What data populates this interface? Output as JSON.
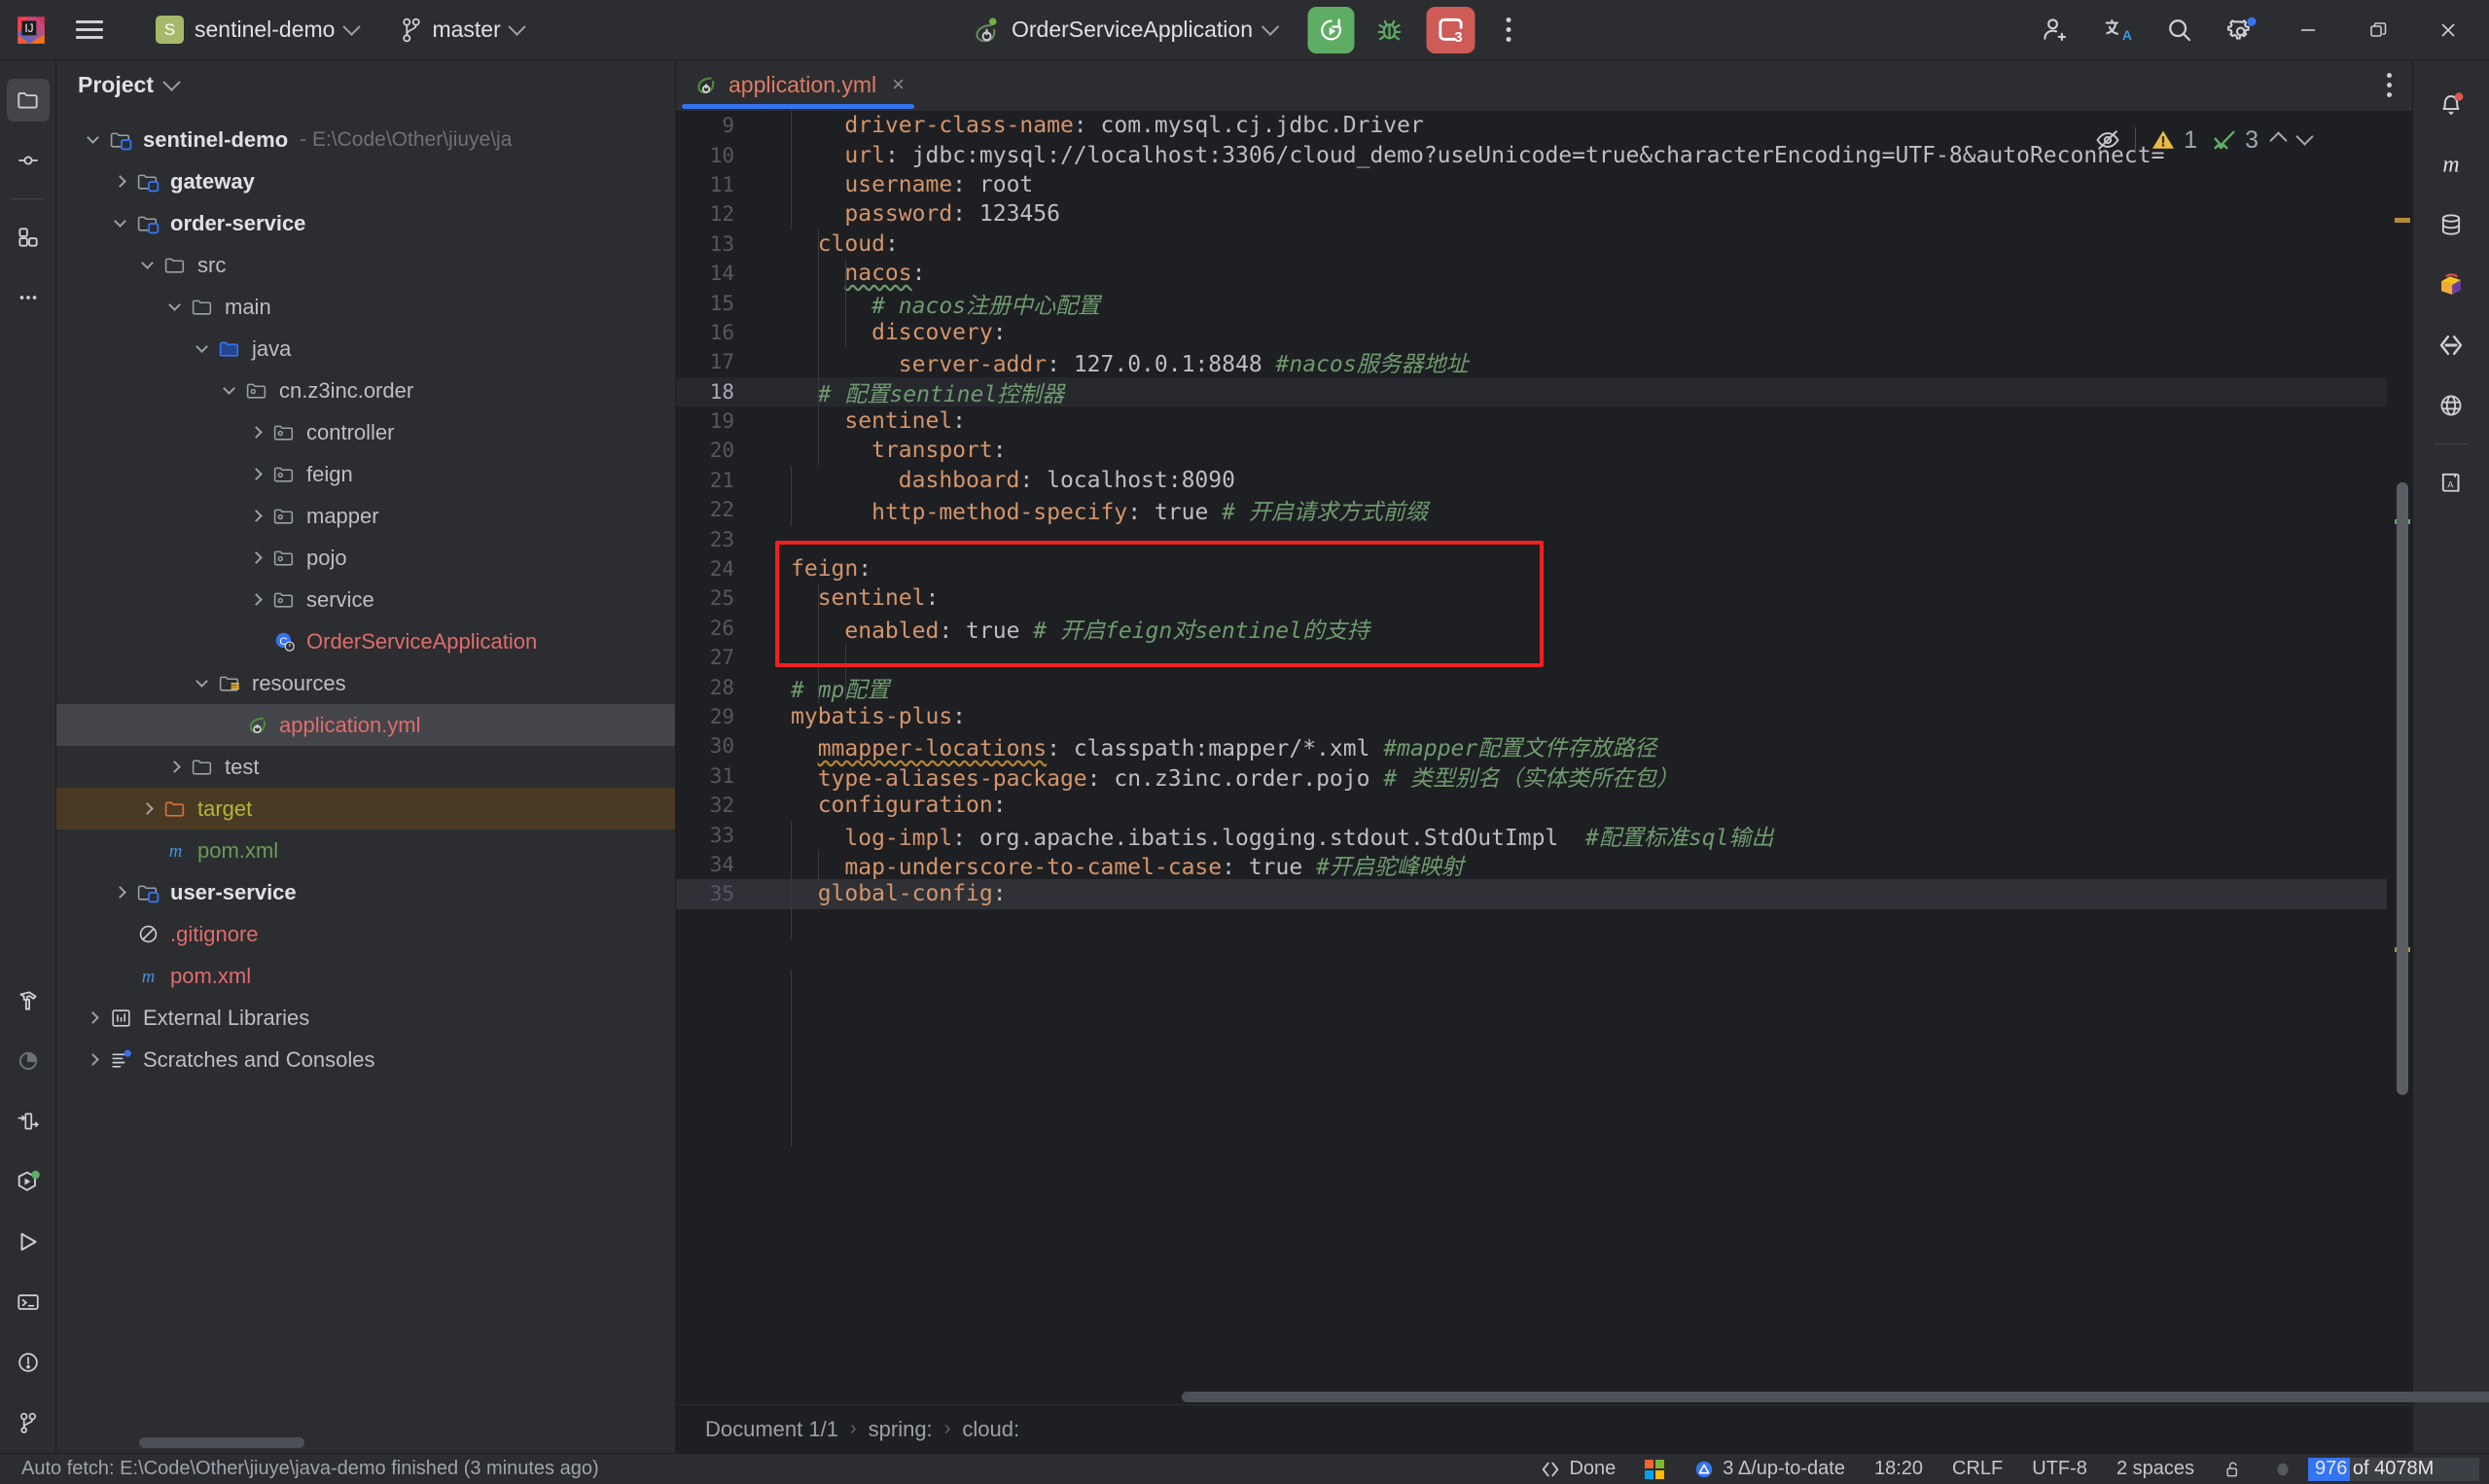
{
  "titlebar": {
    "menu_icon": "hamburger-icon",
    "project_badge": "S",
    "project_name": "sentinel-demo",
    "branch_name": "master",
    "run_config": "OrderServiceApplication",
    "run_button": "run-icon",
    "debug_button": "debug-icon",
    "services_button": "services-icon",
    "services_count": "3",
    "more_button": "more-vertical-icon",
    "right_icons": [
      "add-user-icon",
      "translate-icon",
      "search-icon",
      "settings-icon"
    ],
    "window_controls": [
      "minimize",
      "restore",
      "close"
    ]
  },
  "left_rail": {
    "icons": [
      {
        "name": "project-tool-window",
        "glyph": "folder-icon",
        "active": true
      },
      {
        "name": "commit-tool-window",
        "glyph": "commit-icon",
        "active": false
      },
      {
        "name": "structure-tool-window",
        "glyph": "structure-icon",
        "active": false
      },
      {
        "name": "more-tool-windows",
        "glyph": "more-horizontal-icon",
        "active": false
      },
      {
        "name": "build-tool-window",
        "glyph": "hammer-icon",
        "active": false
      },
      {
        "name": "profiler-tool-window",
        "glyph": "pie-icon",
        "active": false
      },
      {
        "name": "endpoints-tool-window",
        "glyph": "endpoints-icon",
        "active": false
      },
      {
        "name": "services-tool-window",
        "glyph": "services-play-icon",
        "active": false
      },
      {
        "name": "run-tool-window",
        "glyph": "play-icon",
        "active": false
      },
      {
        "name": "terminal-tool-window",
        "glyph": "terminal-icon",
        "active": false
      },
      {
        "name": "problems-tool-window",
        "glyph": "warning-circle-icon",
        "active": false
      },
      {
        "name": "git-tool-window",
        "glyph": "git-branch-icon",
        "active": false
      }
    ]
  },
  "right_rail": {
    "icons": [
      {
        "name": "notifications",
        "glyph": "bell-icon",
        "badge": true
      },
      {
        "name": "maven",
        "glyph": "maven-m-icon"
      },
      {
        "name": "database",
        "glyph": "database-icon"
      },
      {
        "name": "mybatisx",
        "glyph": "mybatisx-icon"
      },
      {
        "name": "codewith-me",
        "glyph": "code-with-me-icon"
      },
      {
        "name": "web-browser",
        "glyph": "globe-icon"
      },
      {
        "name": "translation",
        "glyph": "dictionary-icon"
      }
    ]
  },
  "project_panel": {
    "title": "Project",
    "tree": [
      {
        "depth": 0,
        "arrow": "down",
        "icon": "module-icon",
        "label": "sentinel-demo",
        "bold": true,
        "path": "- E:\\Code\\Other\\jiuye\\ja"
      },
      {
        "depth": 1,
        "arrow": "right",
        "icon": "module-icon",
        "label": "gateway",
        "bold": true
      },
      {
        "depth": 1,
        "arrow": "down",
        "icon": "module-icon",
        "label": "order-service",
        "bold": true
      },
      {
        "depth": 2,
        "arrow": "down",
        "icon": "folder-icon",
        "label": "src"
      },
      {
        "depth": 3,
        "arrow": "down",
        "icon": "folder-icon",
        "label": "main"
      },
      {
        "depth": 4,
        "arrow": "down",
        "icon": "source-root-icon",
        "label": "java"
      },
      {
        "depth": 5,
        "arrow": "down",
        "icon": "package-icon",
        "label": "cn.z3inc.order"
      },
      {
        "depth": 6,
        "arrow": "right",
        "icon": "package-icon",
        "label": "controller"
      },
      {
        "depth": 6,
        "arrow": "right",
        "icon": "package-icon",
        "label": "feign"
      },
      {
        "depth": 6,
        "arrow": "right",
        "icon": "package-icon",
        "label": "mapper"
      },
      {
        "depth": 6,
        "arrow": "right",
        "icon": "package-icon",
        "label": "pojo"
      },
      {
        "depth": 6,
        "arrow": "right",
        "icon": "package-icon",
        "label": "service"
      },
      {
        "depth": 6,
        "arrow": "none",
        "icon": "spring-class-icon",
        "label": "OrderServiceApplication",
        "color": "red"
      },
      {
        "depth": 4,
        "arrow": "down",
        "icon": "resource-root-icon",
        "label": "resources"
      },
      {
        "depth": 5,
        "arrow": "none",
        "icon": "spring-yml-icon",
        "label": "application.yml",
        "color": "red",
        "selected": true
      },
      {
        "depth": 3,
        "arrow": "right",
        "icon": "folder-icon",
        "label": "test"
      },
      {
        "depth": 2,
        "arrow": "right",
        "icon": "excluded-folder-icon",
        "label": "target",
        "color": "olive",
        "highlight": "target"
      },
      {
        "depth": 2,
        "arrow": "none",
        "icon": "maven-m-icon",
        "label": "pom.xml",
        "color": "green"
      },
      {
        "depth": 1,
        "arrow": "right",
        "icon": "module-icon",
        "label": "user-service",
        "bold": true
      },
      {
        "depth": 1,
        "arrow": "none",
        "icon": "gitignore-icon",
        "label": ".gitignore",
        "color": "red"
      },
      {
        "depth": 1,
        "arrow": "none",
        "icon": "maven-m-icon",
        "label": "pom.xml",
        "color": "red"
      },
      {
        "depth": 0,
        "arrow": "right",
        "icon": "libraries-icon",
        "label": "External Libraries"
      },
      {
        "depth": 0,
        "arrow": "right",
        "icon": "scratches-icon",
        "label": "Scratches and Consoles"
      }
    ]
  },
  "editor": {
    "tab": {
      "label": "application.yml",
      "icon": "spring-yml-icon",
      "close": "×"
    },
    "tabbar_more": "more-vertical-icon",
    "inspection_widget": {
      "hide_icon": "eye-crossed-icon",
      "warning_icon": "warning-triangle-icon",
      "warning_count": "1",
      "ok_icon": "check-squiggle-icon",
      "ok_count": "3",
      "prev_icon": "chevron-up-icon",
      "next_icon": "chevron-down-icon"
    },
    "lines": [
      {
        "n": "9",
        "indent": 2,
        "tokens": [
          {
            "t": "driver-class-name",
            "c": "k"
          },
          {
            "t": ": ",
            "c": "p"
          },
          {
            "t": "com.mysql.cj.jdbc.Driver",
            "c": "v"
          }
        ]
      },
      {
        "n": "10",
        "indent": 2,
        "tokens": [
          {
            "t": "url",
            "c": "k"
          },
          {
            "t": ": ",
            "c": "p"
          },
          {
            "t": "jdbc:mysql://localhost:3306/cloud_demo?useUnicode=true&characterEncoding=UTF-8&autoReconnect=",
            "c": "v"
          }
        ]
      },
      {
        "n": "11",
        "indent": 2,
        "tokens": [
          {
            "t": "username",
            "c": "k"
          },
          {
            "t": ": ",
            "c": "p"
          },
          {
            "t": "root",
            "c": "v"
          }
        ]
      },
      {
        "n": "12",
        "indent": 2,
        "tokens": [
          {
            "t": "password",
            "c": "k"
          },
          {
            "t": ": ",
            "c": "p"
          },
          {
            "t": "123456",
            "c": "v"
          }
        ]
      },
      {
        "n": "13",
        "indent": 1,
        "tokens": [
          {
            "t": "cloud",
            "c": "k"
          },
          {
            "t": ":",
            "c": "p"
          }
        ]
      },
      {
        "n": "14",
        "indent": 2,
        "tokens": [
          {
            "t": "nacos",
            "c": "k squig"
          },
          {
            "t": ":",
            "c": "p"
          }
        ]
      },
      {
        "n": "15",
        "indent": 3,
        "tokens": [
          {
            "t": "# nacos注册中心配置",
            "c": "cm"
          }
        ]
      },
      {
        "n": "16",
        "indent": 3,
        "tokens": [
          {
            "t": "discovery",
            "c": "k"
          },
          {
            "t": ":",
            "c": "p"
          }
        ]
      },
      {
        "n": "17",
        "indent": 4,
        "tokens": [
          {
            "t": "server-addr",
            "c": "k"
          },
          {
            "t": ": ",
            "c": "p"
          },
          {
            "t": "127.0.0.1:8848 ",
            "c": "v"
          },
          {
            "t": "#nacos服务器地址",
            "c": "cm"
          }
        ]
      },
      {
        "n": "18",
        "indent": 1,
        "hl": true,
        "tokens": [
          {
            "t": "# 配置sentinel控制器",
            "c": "cm"
          }
        ]
      },
      {
        "n": "19",
        "indent": 2,
        "tokens": [
          {
            "t": "sentinel",
            "c": "k"
          },
          {
            "t": ":",
            "c": "p"
          }
        ]
      },
      {
        "n": "20",
        "indent": 3,
        "tokens": [
          {
            "t": "transport",
            "c": "k"
          },
          {
            "t": ":",
            "c": "p"
          }
        ]
      },
      {
        "n": "21",
        "indent": 4,
        "tokens": [
          {
            "t": "dashboard",
            "c": "k"
          },
          {
            "t": ": ",
            "c": "p"
          },
          {
            "t": "localhost:8090",
            "c": "v"
          }
        ]
      },
      {
        "n": "22",
        "indent": 3,
        "tokens": [
          {
            "t": "http-method-specify",
            "c": "k"
          },
          {
            "t": ": ",
            "c": "p"
          },
          {
            "t": "true ",
            "c": "v"
          },
          {
            "t": "# 开启请求方式前缀",
            "c": "cm"
          }
        ]
      },
      {
        "n": "23",
        "indent": 0,
        "tokens": []
      },
      {
        "n": "24",
        "indent": 0,
        "tokens": [
          {
            "t": "feign",
            "c": "k"
          },
          {
            "t": ":",
            "c": "p"
          }
        ]
      },
      {
        "n": "25",
        "indent": 1,
        "tokens": [
          {
            "t": "sentinel",
            "c": "k"
          },
          {
            "t": ":",
            "c": "p"
          }
        ]
      },
      {
        "n": "26",
        "indent": 2,
        "tokens": [
          {
            "t": "enabled",
            "c": "k"
          },
          {
            "t": ": ",
            "c": "p"
          },
          {
            "t": "true ",
            "c": "v"
          },
          {
            "t": "# 开启feign对sentinel的支持",
            "c": "cm"
          }
        ]
      },
      {
        "n": "27",
        "indent": 0,
        "tokens": []
      },
      {
        "n": "28",
        "indent": 0,
        "tokens": [
          {
            "t": "# mp配置",
            "c": "cm"
          }
        ]
      },
      {
        "n": "29",
        "indent": 0,
        "tokens": [
          {
            "t": "mybatis-plus",
            "c": "k"
          },
          {
            "t": ":",
            "c": "p"
          }
        ]
      },
      {
        "n": "30",
        "indent": 1,
        "tokens": [
          {
            "t": "mmapper-locations",
            "c": "k squig-y"
          },
          {
            "t": ": ",
            "c": "p"
          },
          {
            "t": "classpath:mapper/*.xml ",
            "c": "v"
          },
          {
            "t": "#mapper配置文件存放路径",
            "c": "cm"
          }
        ]
      },
      {
        "n": "31",
        "indent": 1,
        "tokens": [
          {
            "t": "type-aliases-package",
            "c": "k"
          },
          {
            "t": ": ",
            "c": "p"
          },
          {
            "t": "cn.z3inc.order.pojo ",
            "c": "v"
          },
          {
            "t": "# 类型别名（实体类所在包）",
            "c": "cm"
          }
        ]
      },
      {
        "n": "32",
        "indent": 1,
        "tokens": [
          {
            "t": "configuration",
            "c": "k"
          },
          {
            "t": ":",
            "c": "p"
          }
        ]
      },
      {
        "n": "33",
        "indent": 2,
        "tokens": [
          {
            "t": "log-impl",
            "c": "k"
          },
          {
            "t": ": ",
            "c": "p"
          },
          {
            "t": "org.apache.ibatis.logging.stdout.StdOutImpl  ",
            "c": "v"
          },
          {
            "t": "#配置标准sql输出",
            "c": "cm"
          }
        ]
      },
      {
        "n": "34",
        "indent": 2,
        "tokens": [
          {
            "t": "map-underscore-to-camel-case",
            "c": "k"
          },
          {
            "t": ": ",
            "c": "p"
          },
          {
            "t": "true ",
            "c": "v"
          },
          {
            "t": "#开启驼峰映射",
            "c": "cm"
          }
        ]
      },
      {
        "n": "35",
        "indent": 1,
        "hl2": true,
        "tokens": [
          {
            "t": "global-config",
            "c": "k"
          },
          {
            "t": ":",
            "c": "p"
          }
        ]
      }
    ],
    "highlight_box": {
      "color": "#f02020",
      "from_line": "24",
      "to_line": "27"
    },
    "breadcrumbs": [
      {
        "label": "Document 1/1"
      },
      {
        "label": "spring:"
      },
      {
        "label": "cloud:"
      }
    ],
    "breadcrumb_separator": "›"
  },
  "statusbar": {
    "left_message": "Auto fetch: E:\\Code\\Other\\jiuye\\java-demo finished (3 minutes ago)",
    "items": [
      {
        "name": "code-with-me-status",
        "icon": "code-with-me-icon",
        "label": "Done"
      },
      {
        "name": "windows-icon",
        "icon": "windows-logo-icon",
        "label": ""
      },
      {
        "name": "update-status",
        "icon": "update-triangle-icon",
        "label": "3 Δ/up-to-date"
      },
      {
        "name": "time",
        "icon": "",
        "label": "18:20"
      },
      {
        "name": "line-separator",
        "icon": "",
        "label": "CRLF"
      },
      {
        "name": "file-encoding",
        "icon": "",
        "label": "UTF-8"
      },
      {
        "name": "indent",
        "icon": "",
        "label": "2 spaces"
      },
      {
        "name": "read-only-toggle",
        "icon": "lock-open-icon",
        "label": ""
      },
      {
        "name": "inspection-widget",
        "icon": "inspection-dot-icon",
        "label": ""
      }
    ],
    "memory": {
      "used": "976",
      "suffix": " of 4078M"
    }
  }
}
